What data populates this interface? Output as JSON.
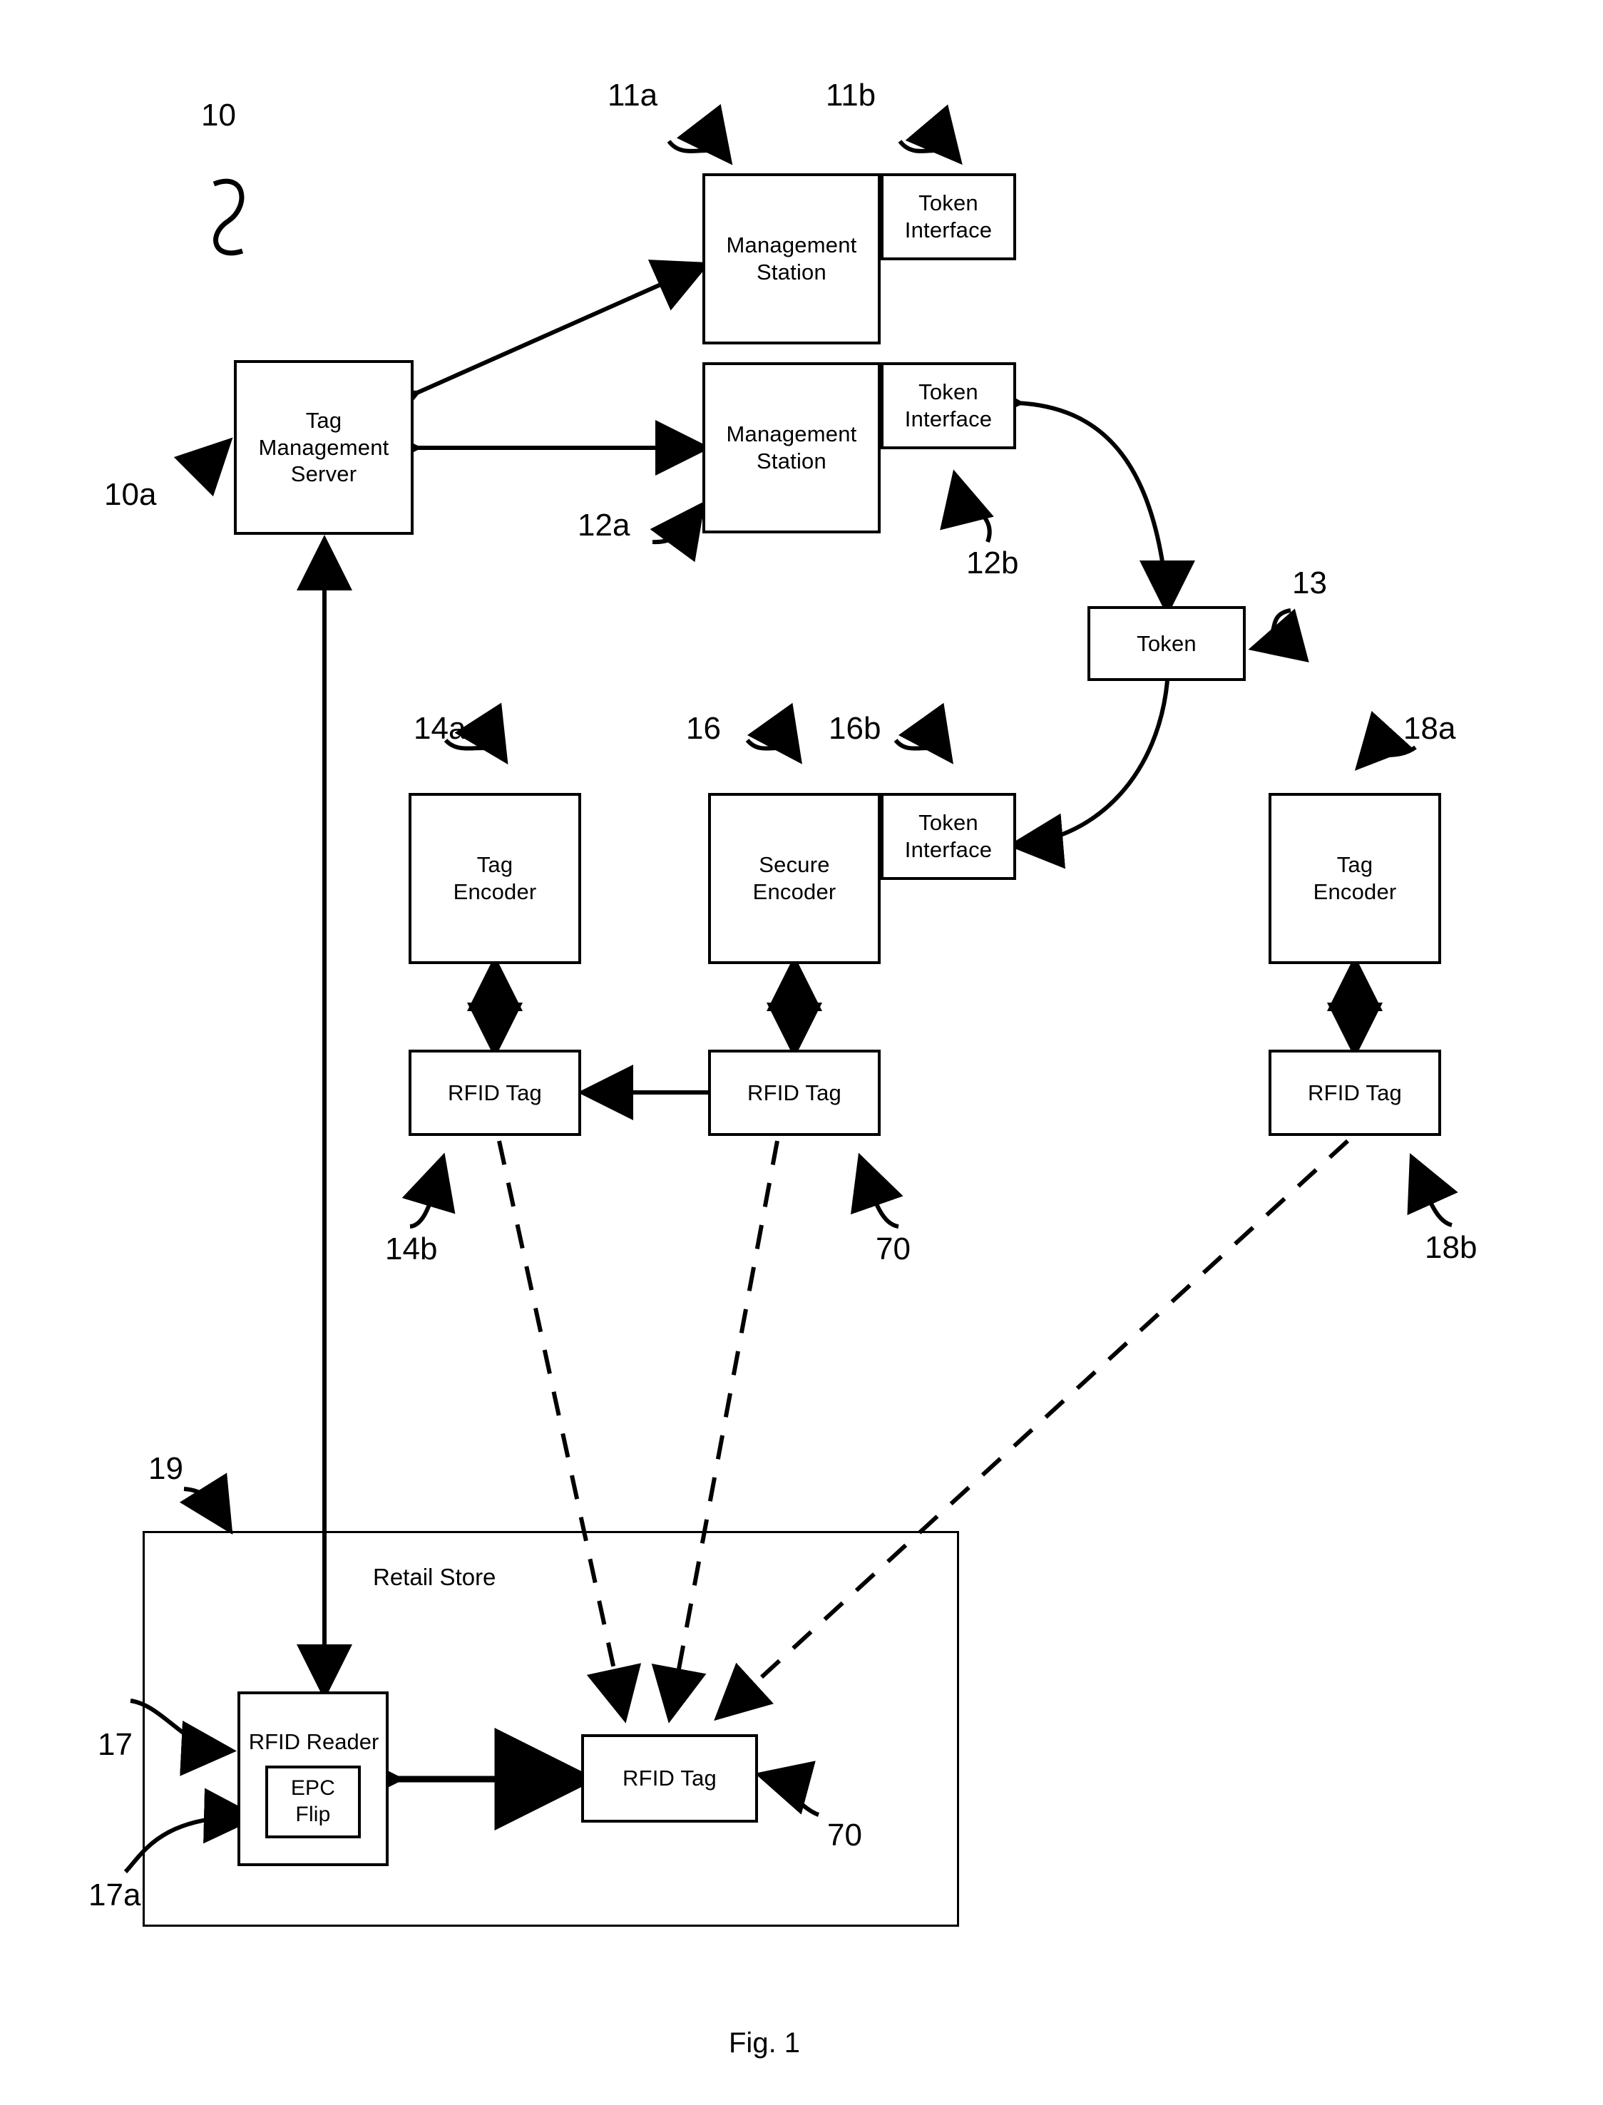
{
  "figure": {
    "caption": "Fig. 1",
    "title": "RFID tag management system block diagram"
  },
  "nodes": {
    "tag_management_server": "Tag\nManagement\nServer",
    "management_station_top": "Management\nStation",
    "token_interface_top": "Token\nInterface",
    "management_station_mid": "Management\nStation",
    "token_interface_mid": "Token\nInterface",
    "token": "Token",
    "tag_encoder_left": "Tag\nEncoder",
    "secure_encoder": "Secure\nEncoder",
    "token_interface_secure": "Token\nInterface",
    "tag_encoder_right": "Tag\nEncoder",
    "rfid_tag_left": "RFID Tag",
    "rfid_tag_mid": "RFID Tag",
    "rfid_tag_right": "RFID Tag",
    "retail_store": "Retail Store",
    "rfid_reader": "RFID Reader",
    "epc_flip": "EPC\nFlip",
    "rfid_tag_store": "RFID Tag"
  },
  "reference_numerals": [
    {
      "id": "10",
      "label": "10"
    },
    {
      "id": "10a",
      "label": "10a"
    },
    {
      "id": "11a",
      "label": "11a"
    },
    {
      "id": "11b",
      "label": "11b"
    },
    {
      "id": "12a",
      "label": "12a"
    },
    {
      "id": "12b",
      "label": "12b"
    },
    {
      "id": "13",
      "label": "13"
    },
    {
      "id": "14a",
      "label": "14a"
    },
    {
      "id": "14b",
      "label": "14b"
    },
    {
      "id": "16",
      "label": "16"
    },
    {
      "id": "16b",
      "label": "16b"
    },
    {
      "id": "17",
      "label": "17"
    },
    {
      "id": "17a",
      "label": "17a"
    },
    {
      "id": "18a",
      "label": "18a"
    },
    {
      "id": "18b",
      "label": "18b"
    },
    {
      "id": "19",
      "label": "19"
    },
    {
      "id": "70a",
      "label": "70"
    },
    {
      "id": "70b",
      "label": "70"
    }
  ],
  "style": {
    "ink": "#000000",
    "paper": "#ffffff"
  }
}
